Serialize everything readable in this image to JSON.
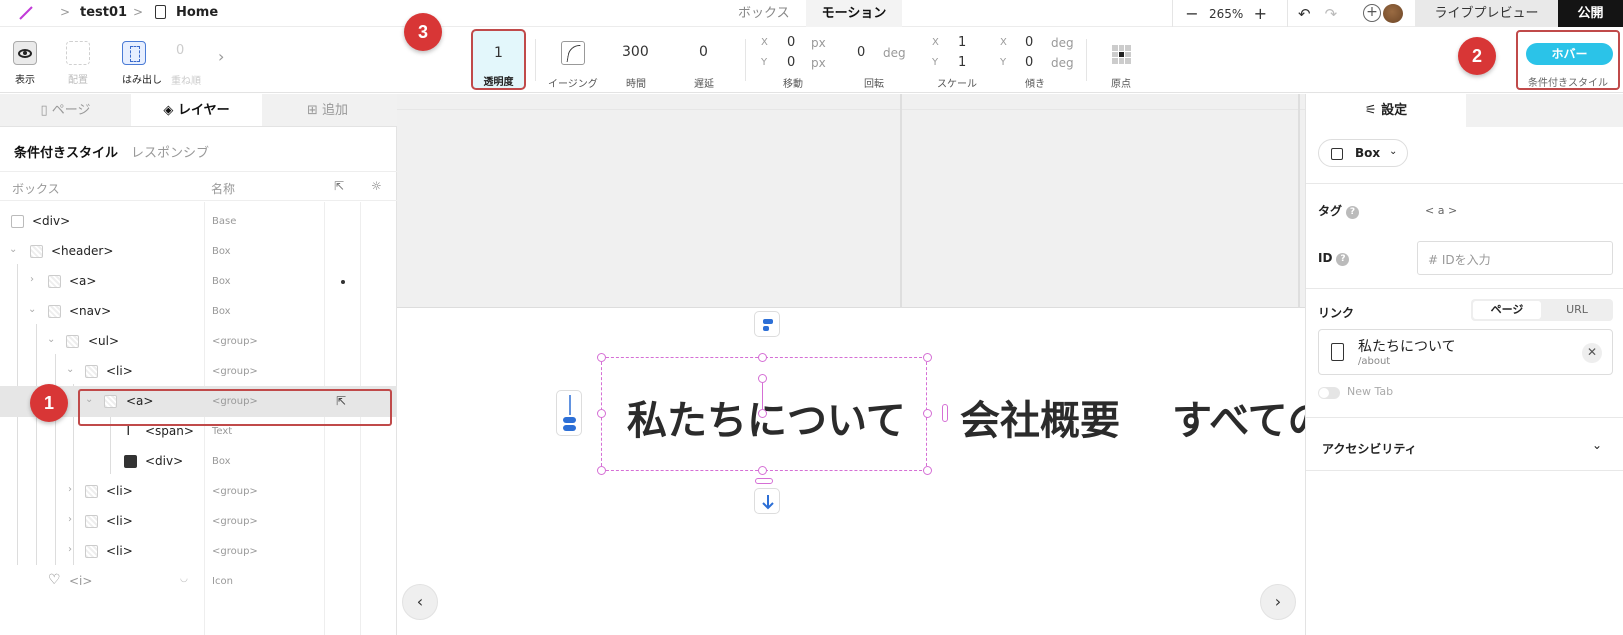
{
  "topbar": {
    "project": "test01",
    "page": "Home",
    "tabs": [
      "ボックス",
      "モーション"
    ],
    "active_tab": "モーション",
    "zoom": "265%",
    "zoom_minus": "−",
    "zoom_plus": "+",
    "preview": "ライブプレビュー",
    "publish": "公開"
  },
  "toolbar": {
    "show_label": "表示",
    "place_label": "配置",
    "overflow_label": "はみ出し",
    "zero_value": "0",
    "zero_label": "重ね順",
    "opacity": {
      "value": "1",
      "label": "透明度"
    },
    "easing_label": "イージング",
    "duration": {
      "value": "300",
      "label": "時間"
    },
    "delay": {
      "value": "0",
      "label": "遅延"
    },
    "move": {
      "x": "0",
      "y": "0",
      "unit": "px",
      "label": "移動"
    },
    "rotate": {
      "value": "0",
      "unit": "deg",
      "label": "回転"
    },
    "scale": {
      "x": "1",
      "y": "1",
      "label": "スケール"
    },
    "skew": {
      "x": "0",
      "y": "0",
      "unit": "deg",
      "label": "傾き"
    },
    "origin_label": "原点",
    "axis_x": "X",
    "axis_y": "Y",
    "hover": {
      "pill": "ホバー",
      "label": "条件付きスタイル"
    }
  },
  "markers": [
    "1",
    "2",
    "3"
  ],
  "left_panel": {
    "tabs": [
      "ページ",
      "レイヤー",
      "追加"
    ],
    "active_tab": "レイヤー",
    "subtabs": [
      "条件付きスタイル",
      "レスポンシブ"
    ],
    "col_box": "ボックス",
    "col_name": "名称",
    "rows": [
      {
        "tag": "<div>",
        "name": "Base"
      },
      {
        "tag": "<header>",
        "name": "Box"
      },
      {
        "tag": "<a>",
        "name": "Box"
      },
      {
        "tag": "<nav>",
        "name": "Box"
      },
      {
        "tag": "<ul>",
        "name": "<group>"
      },
      {
        "tag": "<li>",
        "name": "<group>"
      },
      {
        "tag": "<a>",
        "name": "<group>"
      },
      {
        "tag": "<span>",
        "name": "Text"
      },
      {
        "tag": "<div>",
        "name": "Box"
      },
      {
        "tag": "<li>",
        "name": "<group>"
      },
      {
        "tag": "<li>",
        "name": "<group>"
      },
      {
        "tag": "<li>",
        "name": "<group>"
      },
      {
        "tag": "<i>",
        "name": "Icon"
      }
    ]
  },
  "canvas": {
    "nav_items": [
      "私たちについて",
      "会社概要",
      "すべての"
    ],
    "prev": "‹",
    "next": "›"
  },
  "right_panel": {
    "tab": "設定",
    "element_type": "Box",
    "tag_label": "タグ",
    "tag_value": "< a >",
    "id_label": "ID",
    "id_placeholder": "# IDを入力",
    "link_label": "リンク",
    "link_modes": [
      "ページ",
      "URL"
    ],
    "link_title": "私たちについて",
    "link_path": "/about",
    "new_tab": "New Tab",
    "accessibility": "アクセシビリティ"
  },
  "colors": {
    "accent": "#2bc3e8",
    "marker": "#d83636",
    "selection": "#d56fd5",
    "publish_bg": "#141414"
  }
}
